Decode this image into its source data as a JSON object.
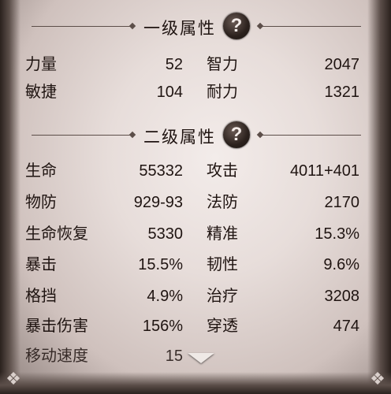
{
  "primary": {
    "title": "一级属性",
    "help_icon": "?",
    "rows": [
      {
        "left_label": "力量",
        "left_value": "52",
        "right_label": "智力",
        "right_value": "2047"
      },
      {
        "left_label": "敏捷",
        "left_value": "104",
        "right_label": "耐力",
        "right_value": "1321"
      }
    ]
  },
  "secondary": {
    "title": "二级属性",
    "help_icon": "?",
    "rows": [
      {
        "left_label": "生命",
        "left_value": "55332",
        "right_label": "攻击",
        "right_value": "4011+401"
      },
      {
        "left_label": "物防",
        "left_value": "929-93",
        "right_label": "法防",
        "right_value": "2170"
      },
      {
        "left_label": "生命恢复",
        "left_value": "5330",
        "right_label": "精准",
        "right_value": "15.3%"
      },
      {
        "left_label": "暴击",
        "left_value": "15.5%",
        "right_label": "韧性",
        "right_value": "9.6%"
      },
      {
        "left_label": "格挡",
        "left_value": "4.9%",
        "right_label": "治疗",
        "right_value": "3208"
      },
      {
        "left_label": "暴击伤害",
        "left_value": "156%",
        "right_label": "穿透",
        "right_value": "474"
      },
      {
        "left_label": "移动速度",
        "left_value": "15"
      }
    ]
  },
  "icons": {
    "help": "question-mark-circle-icon",
    "scroll": "chevron-down-icon",
    "corner": "corner-ornament-icon"
  }
}
